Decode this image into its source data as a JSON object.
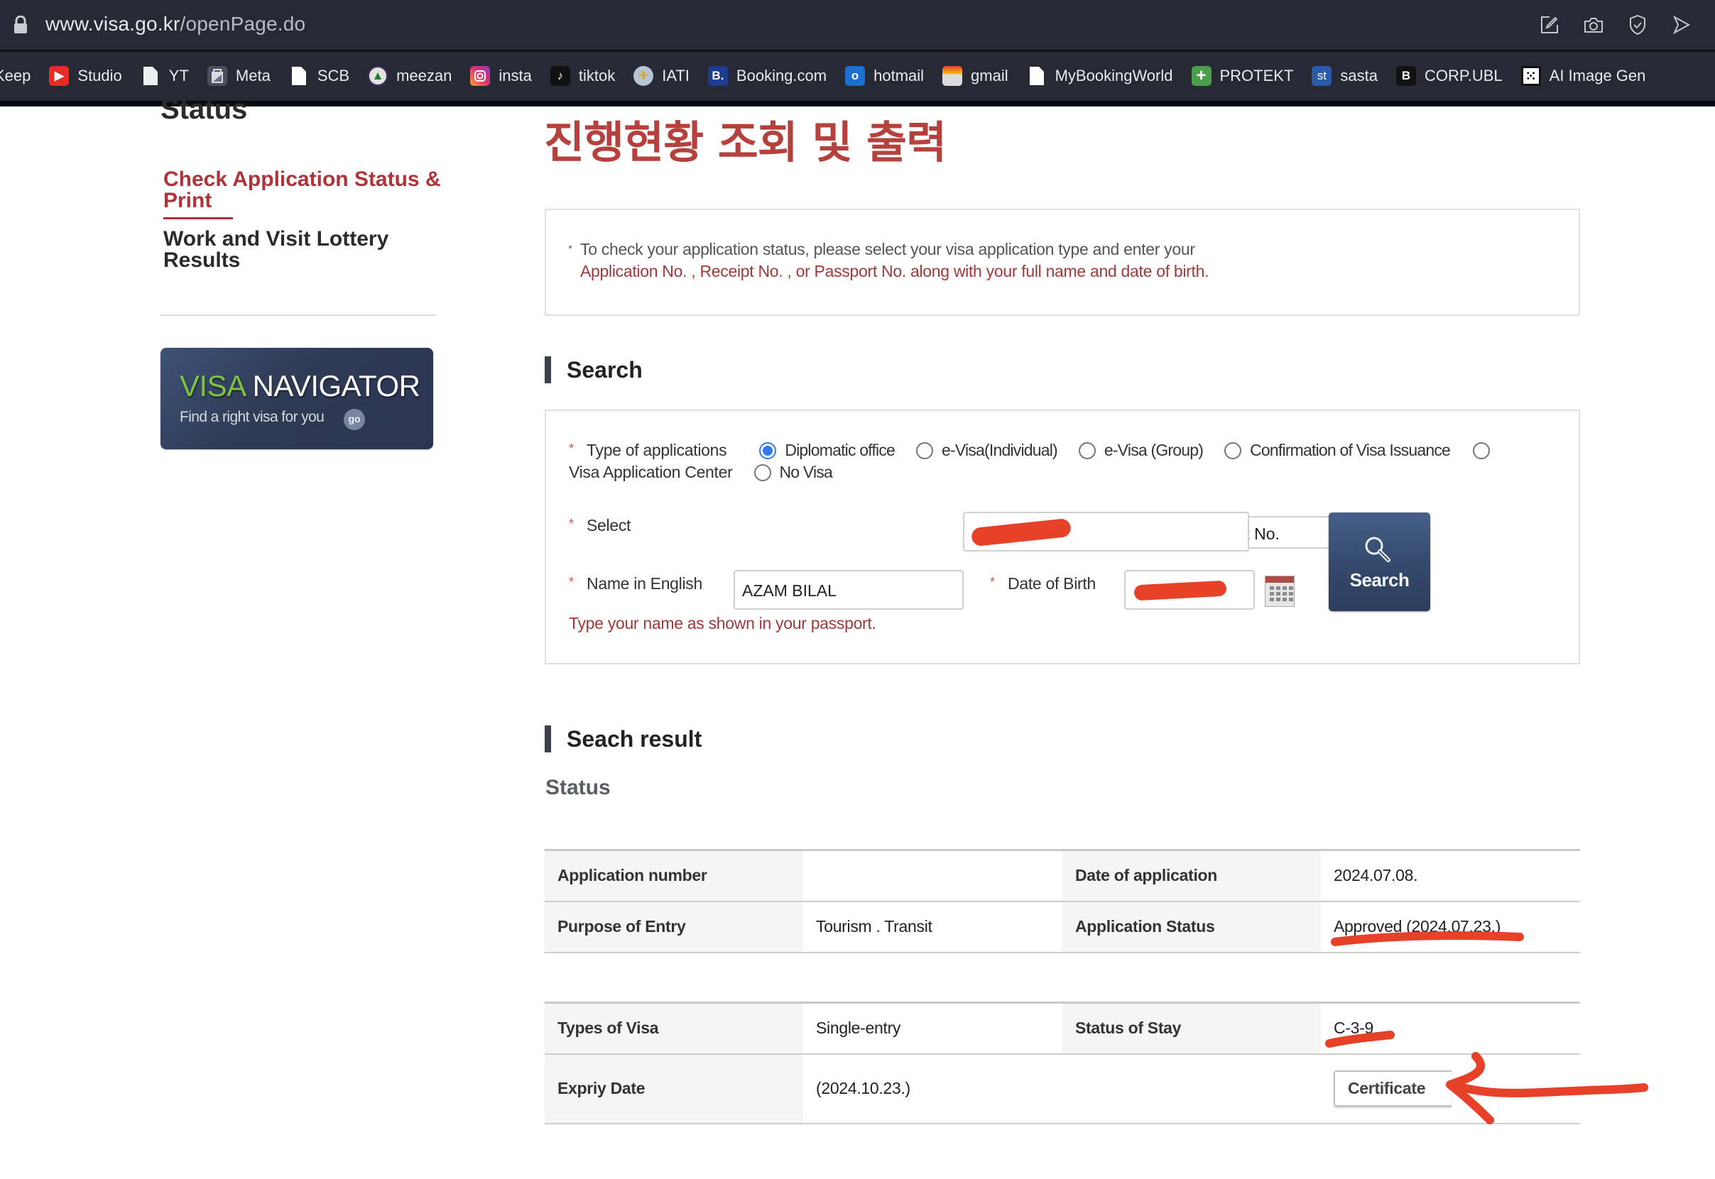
{
  "browser": {
    "url_host": "www.visa.go.kr",
    "url_path": "/openPage.do",
    "toolbar_icons": [
      "edit-pin-icon",
      "camera-icon",
      "shield-check-icon",
      "send-icon"
    ],
    "bookmarks": [
      {
        "label": "Keep",
        "icon": "none"
      },
      {
        "label": "Studio",
        "icon": "youtube-studio-icon"
      },
      {
        "label": "YT",
        "icon": "document-icon"
      },
      {
        "label": "Meta",
        "icon": "meta-icon"
      },
      {
        "label": "SCB",
        "icon": "document-icon"
      },
      {
        "label": "meezan",
        "icon": "meezan-bank-icon"
      },
      {
        "label": "insta",
        "icon": "instagram-icon"
      },
      {
        "label": "tiktok",
        "icon": "tiktok-icon"
      },
      {
        "label": "IATI",
        "icon": "iati-icon"
      },
      {
        "label": "Booking.com",
        "icon": "booking-icon"
      },
      {
        "label": "hotmail",
        "icon": "outlook-icon"
      },
      {
        "label": "gmail",
        "icon": "gmail-icon"
      },
      {
        "label": "MyBookingWorld",
        "icon": "document-icon"
      },
      {
        "label": "PROTEKT",
        "icon": "protekt-icon"
      },
      {
        "label": "sasta",
        "icon": "sasta-icon"
      },
      {
        "label": "CORP.UBL",
        "icon": "ubl-icon"
      },
      {
        "label": "AI Image Gen",
        "icon": "dice-icon"
      }
    ]
  },
  "sidebar": {
    "section_title": "Status",
    "items": [
      {
        "label": "Check Application Status & Print",
        "active": true
      },
      {
        "label": "Work and Visit Lottery Results",
        "active": false
      }
    ],
    "banner": {
      "title_accent": "VISA",
      "title_rest": " NAVIGATOR",
      "subtitle": "Find a right visa for you",
      "go_label": "go"
    }
  },
  "main": {
    "title": "진행현황 조회 및 출력",
    "info": {
      "line1": "To check your application status, please select your visa application type and enter your",
      "line2": "Application No. , Receipt No. , or Passport No. along with your full name and date of birth."
    },
    "search": {
      "heading": "Search",
      "type_label": "Type of applications",
      "type_options": [
        {
          "label": "Diplomatic office",
          "checked": true
        },
        {
          "label": "e-Visa(Individual)",
          "checked": false
        },
        {
          "label": "e-Visa (Group)",
          "checked": false
        },
        {
          "label": "Confirmation of Visa Issuance",
          "checked": false
        },
        {
          "label": "Visa Application Center",
          "checked": false
        },
        {
          "label": "No Visa",
          "checked": false
        }
      ],
      "select_label": "Select",
      "select_value": "Passport No.",
      "passport_value": "[redacted]",
      "name_label": "Name in English",
      "name_value": "AZAM BILAL",
      "dob_label": "Date of Birth",
      "dob_value": "[redacted]",
      "hint": "Type your name as shown in your passport.",
      "button_label": "Search"
    },
    "result": {
      "heading": "Seach result",
      "subheading": "Status",
      "table1": [
        {
          "label1": "Application number",
          "value1": "",
          "label2": "Date of application",
          "value2": "2024.07.08."
        },
        {
          "label1": "Purpose of Entry",
          "value1": "Tourism . Transit",
          "label2": "Application Status",
          "value2": "Approved (2024.07.23.)"
        }
      ],
      "table2": [
        {
          "label1": "Types of Visa",
          "value1": "Single-entry",
          "label2": "Status of Stay",
          "value2": "C-3-9"
        },
        {
          "label1": "Expriy Date",
          "value1": "(2024.10.23.)",
          "label2": "",
          "value2": ""
        }
      ],
      "certificate_label": "Certificate"
    }
  },
  "annotation_color": "#e8412a"
}
